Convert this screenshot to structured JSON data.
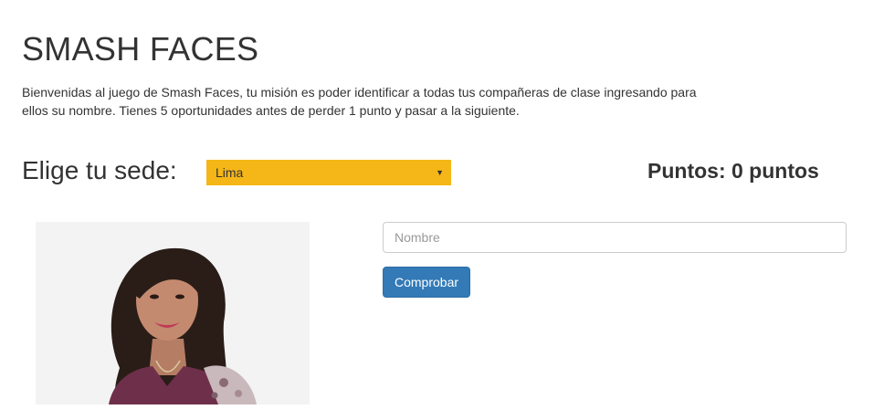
{
  "header": {
    "title": "SMASH FACES",
    "intro": "Bienvenidas al juego de Smash Faces, tu misión es poder identificar a todas tus compañeras de clase ingresando para ellos su nombre. Tienes 5 oportunidades antes de perder 1 punto y pasar a la siguiente."
  },
  "sede": {
    "label": "Elige tu sede:",
    "selected": "Lima",
    "accent_color": "#f5b618"
  },
  "score": {
    "text": "Puntos: 0 puntos"
  },
  "guess": {
    "placeholder": "Nombre",
    "value": "",
    "button_label": "Comprobar",
    "button_color": "#337ab7"
  },
  "photo": {
    "icon": "student-portrait"
  }
}
